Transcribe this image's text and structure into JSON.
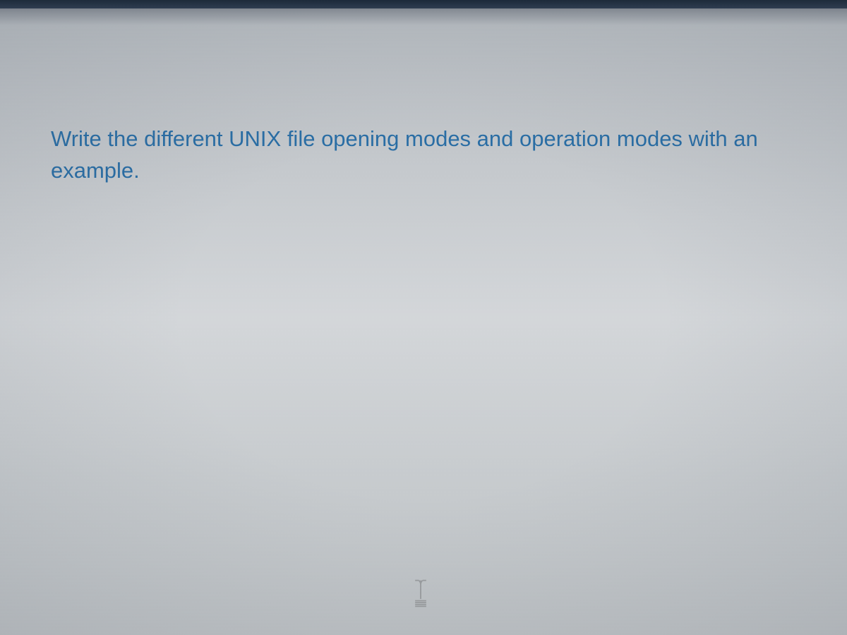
{
  "question": {
    "text": "Write the different UNIX file opening modes and operation modes with an example."
  },
  "colors": {
    "text_color": "#2a6ea5",
    "background_top": "#b8bdc2",
    "background_bottom": "#bfc3c6"
  },
  "cursor": {
    "name": "text-cursor-icon"
  }
}
